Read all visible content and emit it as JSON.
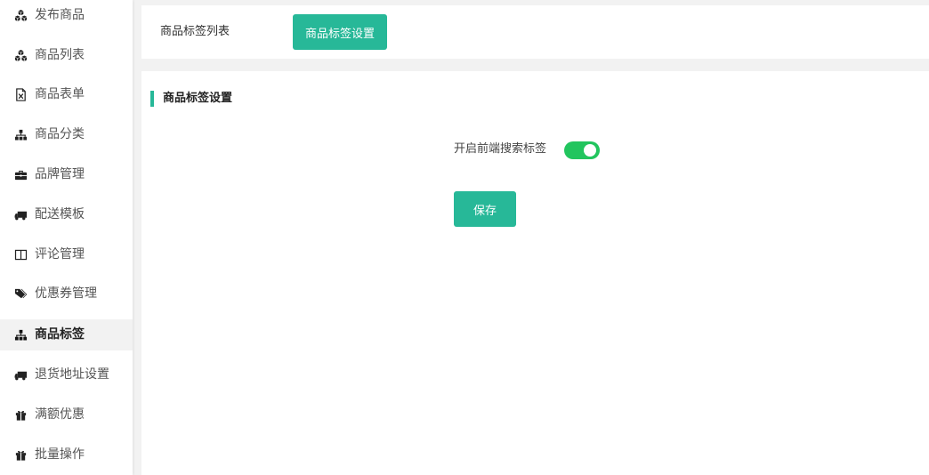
{
  "colors": {
    "accent": "#27b898",
    "switch_on": "#22c55e"
  },
  "sidebar": {
    "active_index": 8,
    "items": [
      {
        "label": "发布商品",
        "icon": "cubes-icon"
      },
      {
        "label": "商品列表",
        "icon": "cubes-icon"
      },
      {
        "label": "商品表单",
        "icon": "excel-file-icon"
      },
      {
        "label": "商品分类",
        "icon": "sitemap-icon"
      },
      {
        "label": "品牌管理",
        "icon": "briefcase-icon"
      },
      {
        "label": "配送模板",
        "icon": "truck-icon"
      },
      {
        "label": "评论管理",
        "icon": "columns-icon"
      },
      {
        "label": "优惠券管理",
        "icon": "tags-icon"
      },
      {
        "label": "商品标签",
        "icon": "sitemap-icon"
      },
      {
        "label": "退货地址设置",
        "icon": "truck-icon"
      },
      {
        "label": "满额优惠",
        "icon": "gift-icon"
      },
      {
        "label": "批量操作",
        "icon": "gift-icon"
      }
    ]
  },
  "tabs": {
    "list_label": "商品标签列表",
    "settings_label": "商品标签设置"
  },
  "panel": {
    "title": "商品标签设置",
    "switch_label": "开启前端搜索标签",
    "switch_on": true,
    "save_label": "保存"
  }
}
